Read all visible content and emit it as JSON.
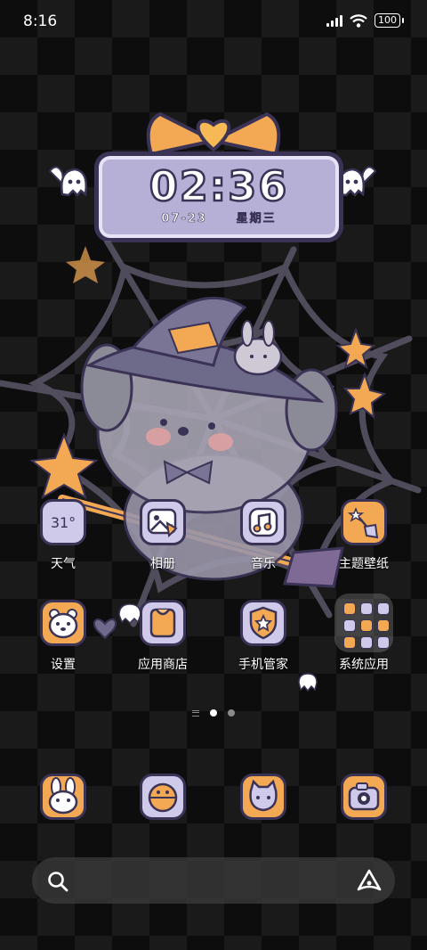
{
  "status_bar": {
    "time": "8:16",
    "battery": "100",
    "icons": [
      "signal-icon",
      "wifi-icon",
      "battery-icon"
    ]
  },
  "clock_widget": {
    "time": "02:36",
    "date": "07-23",
    "weekday": "星期三"
  },
  "apps": [
    {
      "label": "天气",
      "icon": "weather-icon",
      "value": "31°"
    },
    {
      "label": "相册",
      "icon": "gallery-icon"
    },
    {
      "label": "音乐",
      "icon": "music-icon"
    },
    {
      "label": "主题壁纸",
      "icon": "themes-icon"
    },
    {
      "label": "设置",
      "icon": "settings-icon"
    },
    {
      "label": "应用商店",
      "icon": "app-store-icon"
    },
    {
      "label": "手机管家",
      "icon": "security-icon"
    },
    {
      "label": "系统应用",
      "icon": "folder-icon"
    }
  ],
  "dock": [
    {
      "icon": "bunny-phone-icon"
    },
    {
      "icon": "orange-messages-icon"
    },
    {
      "icon": "cat-browser-icon"
    },
    {
      "icon": "camera-icon"
    }
  ],
  "page_indicator": {
    "pages": 2,
    "current": 1
  },
  "colors": {
    "lavender": "#cfc9ea",
    "orange": "#f3a954",
    "outline": "#3b3356"
  }
}
